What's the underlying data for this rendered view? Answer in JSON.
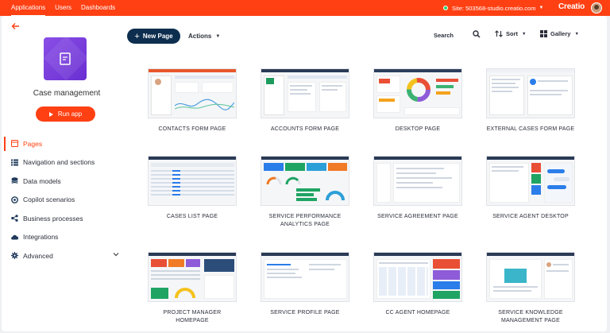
{
  "topbar": {
    "nav": [
      "Applications",
      "Users",
      "Dashboards"
    ],
    "site_label": "Site: 503568-studio.creatio.com",
    "logo": "Creatio",
    "color": "#ff4013"
  },
  "sidebar": {
    "app_title": "Case management",
    "run_label": "Run app",
    "items": [
      {
        "label": "Pages",
        "icon": "pages-icon"
      },
      {
        "label": "Navigation and sections",
        "icon": "list-icon"
      },
      {
        "label": "Data models",
        "icon": "database-icon"
      },
      {
        "label": "Copilot scenarios",
        "icon": "copilot-icon"
      },
      {
        "label": "Business processes",
        "icon": "process-icon"
      },
      {
        "label": "Integrations",
        "icon": "cloud-icon"
      },
      {
        "label": "Advanced",
        "icon": "gear-icon"
      }
    ]
  },
  "toolbar": {
    "new_page": "New Page",
    "actions": "Actions",
    "search": "Search",
    "sort": "Sort",
    "gallery": "Gallery"
  },
  "cards": [
    "CONTACTS FORM PAGE",
    "ACCOUNTS FORM PAGE",
    "DESKTOP PAGE",
    "EXTERNAL CASES FORM PAGE",
    "CASES LIST PAGE",
    "SERVICE PERFORMANCE ANALYTICS PAGE",
    "SERVICE AGREEMENT PAGE",
    "SERVICE AGENT DESKTOP",
    "PROJECT MANAGER HOMEPAGE",
    "SERVICE PROFILE PAGE",
    "CC AGENT HOMEPAGE",
    "SERVICE KNOWLEDGE MANAGEMENT PAGE"
  ]
}
